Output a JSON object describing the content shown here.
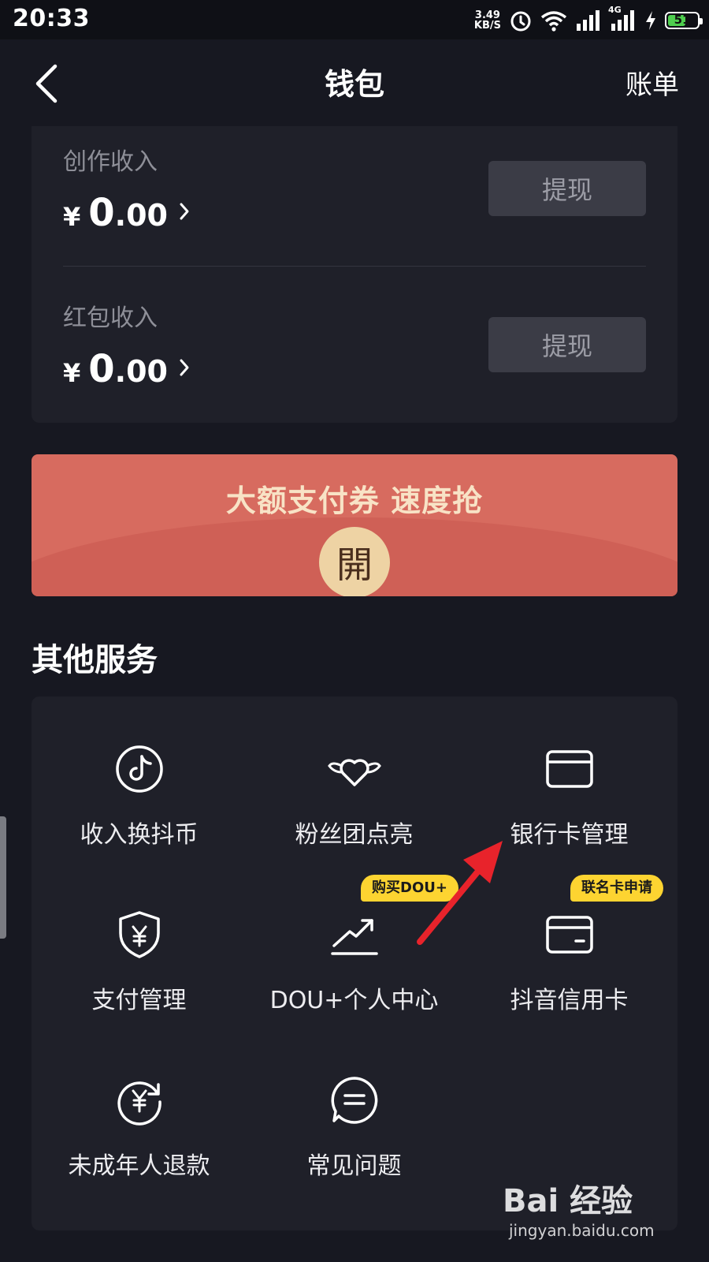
{
  "status_bar": {
    "time": "20:33",
    "speed_value": "3.49",
    "speed_unit": "KB/S",
    "network": "4G",
    "battery": "51",
    "icons": [
      "alarm-icon",
      "wifi-icon",
      "signal-icon",
      "signal-4g-icon",
      "charging-icon",
      "battery-icon"
    ]
  },
  "nav": {
    "back_icon": "chevron-left-icon",
    "title": "钱包",
    "bills_label": "账单"
  },
  "income": [
    {
      "label": "创作收入",
      "currency": "¥",
      "amount_int": "0",
      "amount_dec": ".00",
      "button": "提现"
    },
    {
      "label": "红包收入",
      "currency": "¥",
      "amount_int": "0",
      "amount_dec": ".00",
      "button": "提现"
    }
  ],
  "promo": {
    "text": "大额支付券 速度抢",
    "open_label": "開",
    "colors": {
      "background": "#d76b5f",
      "text": "#f8e3c6",
      "button": "#eed3a4"
    }
  },
  "services": {
    "title": "其他服务",
    "items": [
      {
        "label": "收入换抖币",
        "icon": "tiktok-coin-icon"
      },
      {
        "label": "粉丝团点亮",
        "icon": "winged-heart-icon"
      },
      {
        "label": "银行卡管理",
        "icon": "bank-card-icon"
      },
      {
        "label": "支付管理",
        "icon": "shield-yen-icon"
      },
      {
        "label": "DOU+个人中心",
        "icon": "trend-up-icon",
        "badge": "购买DOU+"
      },
      {
        "label": "抖音信用卡",
        "icon": "credit-card-icon",
        "badge": "联名卡申请"
      },
      {
        "label": "未成年人退款",
        "icon": "refund-yen-icon"
      },
      {
        "label": "常见问题",
        "icon": "chat-bubble-icon"
      }
    ]
  },
  "watermark": {
    "logo": "Bai 经验",
    "url": "jingyan.baidu.com"
  },
  "colors": {
    "background": "#171821",
    "card": "#1f2029",
    "button": "#3b3c46",
    "badge": "#fdd431",
    "annotation": "#e8232b"
  }
}
